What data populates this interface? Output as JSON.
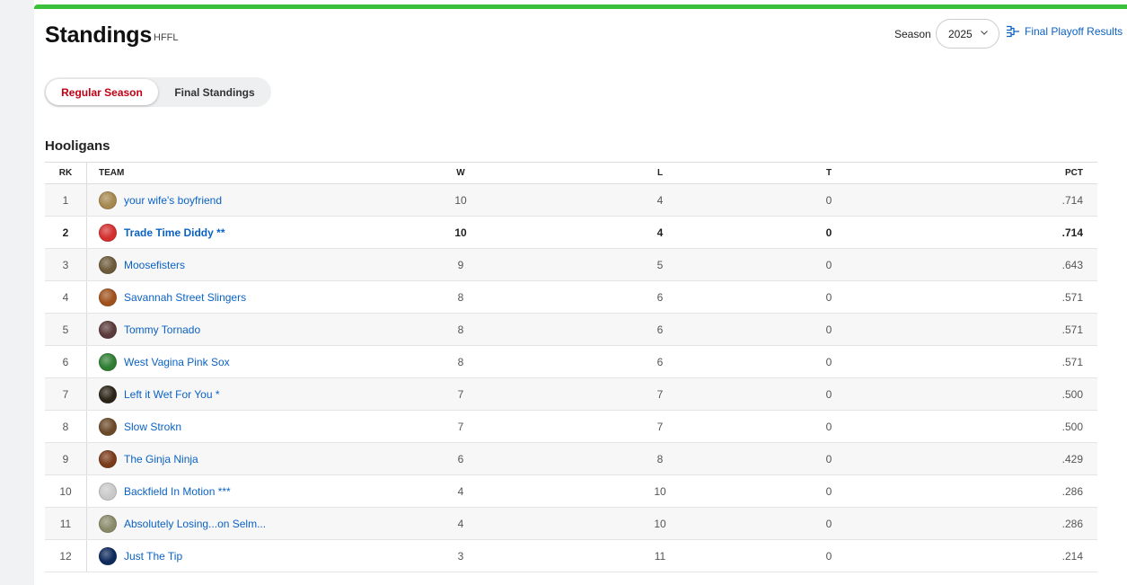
{
  "header": {
    "title": "Standings",
    "league": "HFFL",
    "season_label": "Season",
    "season_value": "2025",
    "playoff_link": "Final Playoff Results"
  },
  "tabs": [
    {
      "label": "Regular Season",
      "active": true
    },
    {
      "label": "Final Standings",
      "active": false
    }
  ],
  "group": {
    "title": "Hooligans",
    "columns": {
      "rk": "RK",
      "team": "TEAM",
      "w": "W",
      "l": "L",
      "t": "T",
      "pct": "PCT"
    },
    "rows": [
      {
        "rk": "1",
        "team": "your wife's boyfriend",
        "w": "10",
        "l": "4",
        "t": "0",
        "pct": ".714",
        "avatar": "#a6884f"
      },
      {
        "rk": "2",
        "team": "Trade Time Diddy **",
        "w": "10",
        "l": "4",
        "t": "0",
        "pct": ".714",
        "avatar": "#d32f2f",
        "mine": true
      },
      {
        "rk": "3",
        "team": "Moosefisters",
        "w": "9",
        "l": "5",
        "t": "0",
        "pct": ".643",
        "avatar": "#6d5a3a"
      },
      {
        "rk": "4",
        "team": "Savannah Street Slingers",
        "w": "8",
        "l": "6",
        "t": "0",
        "pct": ".571",
        "avatar": "#a0521d"
      },
      {
        "rk": "5",
        "team": "Tommy Tornado",
        "w": "8",
        "l": "6",
        "t": "0",
        "pct": ".571",
        "avatar": "#5a3a3a"
      },
      {
        "rk": "6",
        "team": "West Vagina Pink Sox",
        "w": "8",
        "l": "6",
        "t": "0",
        "pct": ".571",
        "avatar": "#2e7d32"
      },
      {
        "rk": "7",
        "team": "Left it Wet For You *",
        "w": "7",
        "l": "7",
        "t": "0",
        "pct": ".500",
        "avatar": "#2b2418"
      },
      {
        "rk": "8",
        "team": "Slow Strokn",
        "w": "7",
        "l": "7",
        "t": "0",
        "pct": ".500",
        "avatar": "#6b4a2a"
      },
      {
        "rk": "9",
        "team": "The Ginja Ninja",
        "w": "6",
        "l": "8",
        "t": "0",
        "pct": ".429",
        "avatar": "#7a3b1a"
      },
      {
        "rk": "10",
        "team": "Backfield In Motion ***",
        "w": "4",
        "l": "10",
        "t": "0",
        "pct": ".286",
        "avatar": "#c9c9c9"
      },
      {
        "rk": "11",
        "team": "Absolutely Losing...on Selm...",
        "w": "4",
        "l": "10",
        "t": "0",
        "pct": ".286",
        "avatar": "#8a8a6a"
      },
      {
        "rk": "12",
        "team": "Just The Tip",
        "w": "3",
        "l": "11",
        "t": "0",
        "pct": ".214",
        "avatar": "#0d2a5c"
      }
    ]
  }
}
